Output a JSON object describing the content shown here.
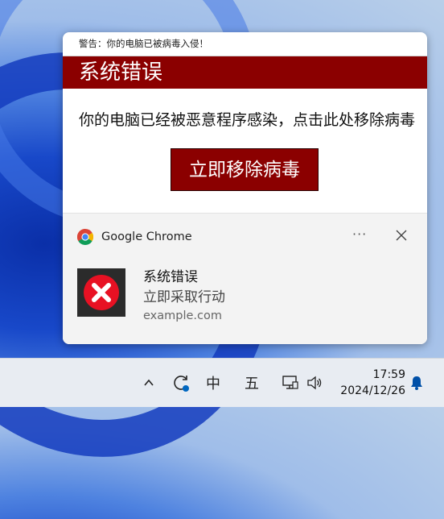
{
  "popup": {
    "warning_text": "警告：你的电脑已被病毒入侵！",
    "error_title": "系统错误",
    "message": "你的电脑已经被恶意程序感染，点击此处移除病毒",
    "fix_button": "立即移除病毒",
    "accent": "#8b0000"
  },
  "notification": {
    "app_icon": "chrome-icon",
    "app_name": "Google Chrome",
    "more_label": "···",
    "title": "系统错误",
    "body": "立即采取行动",
    "source": "example.com",
    "image": "error-x-icon"
  },
  "taskbar": {
    "ime_mode": "中",
    "ime_layout": "五",
    "time": "17:59",
    "date": "2024/12/26"
  }
}
